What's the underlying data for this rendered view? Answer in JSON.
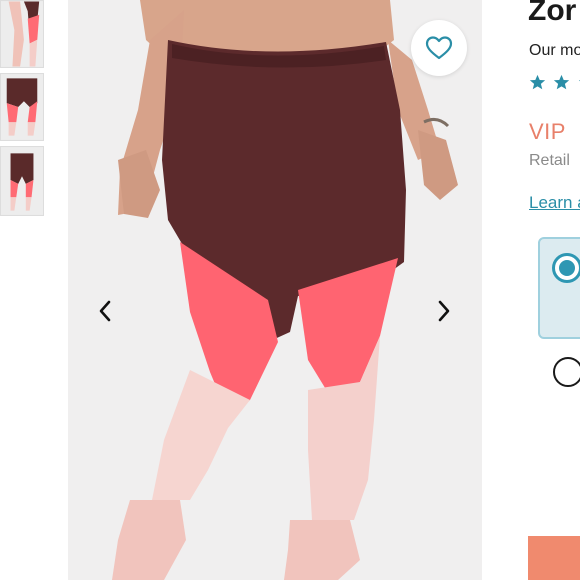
{
  "thumbnails": [
    {
      "name": "thumbnail-1"
    },
    {
      "name": "thumbnail-2"
    },
    {
      "name": "thumbnail-3"
    }
  ],
  "gallery": {
    "favorite_icon": "heart-outline-icon",
    "prev_icon": "chevron-left-icon",
    "next_icon": "chevron-right-icon"
  },
  "product": {
    "title": "Zor",
    "subtitle": "Our mo",
    "rating_icon": "star-icon",
    "star_color": "#2a8ea7",
    "vip_label": "VIP",
    "retail_label": "Retail",
    "learn_link": "Learn a"
  },
  "colors": {
    "accent": "#2a8ea7",
    "vip": "#e8806a",
    "cta": "#f08a6e",
    "option_bg": "#dcebf0"
  }
}
